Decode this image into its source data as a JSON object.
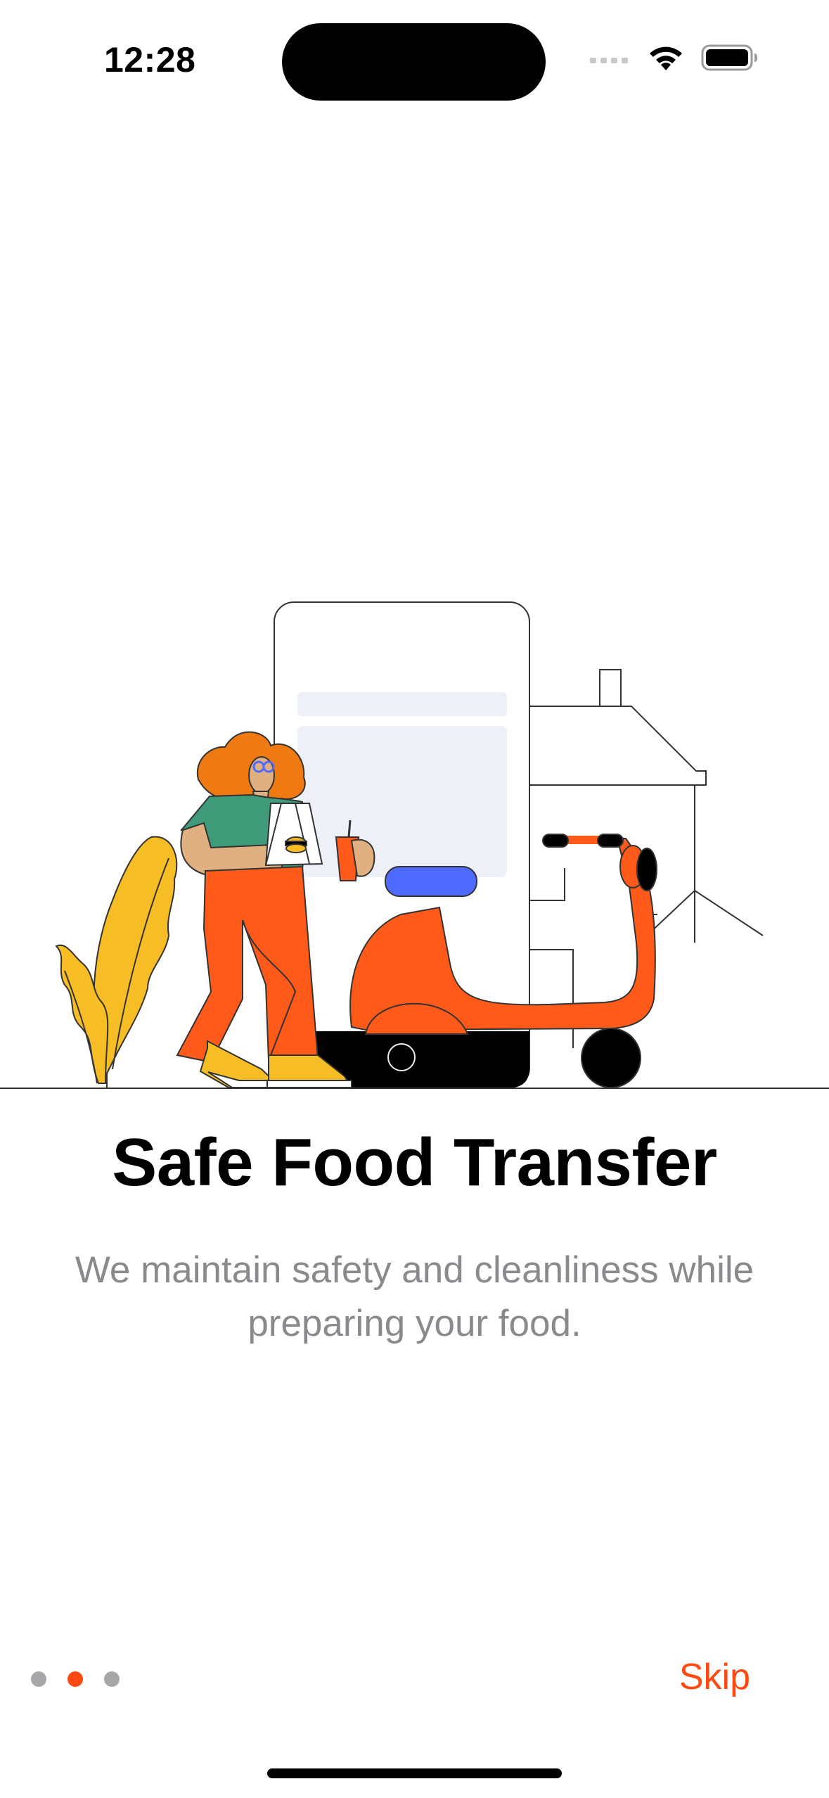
{
  "status_bar": {
    "time": "12:28"
  },
  "onboarding": {
    "title": "Safe Food Transfer",
    "subtitle": "We maintain safety and cleanliness while preparing your food.",
    "pages_total": 3,
    "current_page": 2,
    "skip_label": "Skip"
  },
  "colors": {
    "accent": "#fe4a11",
    "subtitle": "#8a8a8e",
    "dot_inactive": "#a7a7a9",
    "scooter": "#ff5a1a",
    "seat": "#4f6bff",
    "plant": "#f7bd25",
    "shirt": "#3f9b7a",
    "hair": "#ef7a12"
  },
  "icons": {
    "signal": "cellular-signal-icon",
    "wifi": "wifi-icon",
    "battery": "battery-icon"
  }
}
